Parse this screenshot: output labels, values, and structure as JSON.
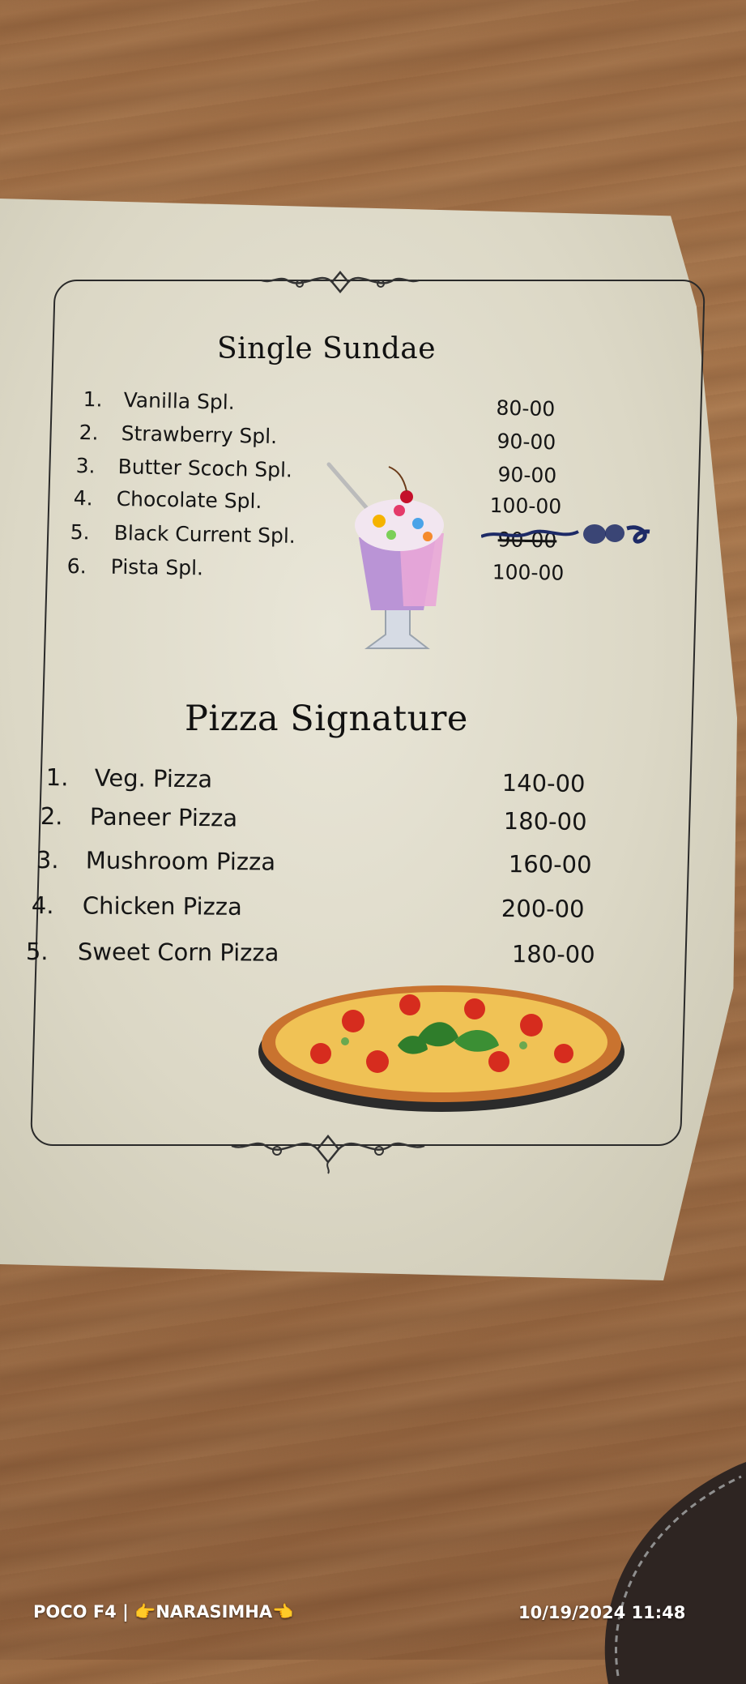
{
  "sections": {
    "sundae": {
      "title": "Single Sundae",
      "items": [
        {
          "num": "1.",
          "name": "Vanilla Spl.",
          "price": "80-00"
        },
        {
          "num": "2.",
          "name": "Strawberry Spl.",
          "price": "90-00"
        },
        {
          "num": "3.",
          "name": "Butter Scoch Spl.",
          "price": "90-00"
        },
        {
          "num": "4.",
          "name": "Chocolate Spl.",
          "price": "100-00"
        },
        {
          "num": "5.",
          "name": "Black Current Spl.",
          "price": "90-00"
        },
        {
          "num": "6.",
          "name": "Pista Spl.",
          "price": "100-00"
        }
      ]
    },
    "pizza": {
      "title": "Pizza Signature",
      "items": [
        {
          "num": "1.",
          "name": "Veg. Pizza",
          "price": "140-00"
        },
        {
          "num": "2.",
          "name": "Paneer Pizza",
          "price": "180-00"
        },
        {
          "num": "3.",
          "name": "Mushroom  Pizza",
          "price": "160-00"
        },
        {
          "num": "4.",
          "name": "Chicken Pizza",
          "price": "200-00"
        },
        {
          "num": "5.",
          "name": "Sweet Corn Pizza",
          "price": "180-00"
        }
      ]
    }
  },
  "watermark": {
    "device": "POCO F4 | 👉NARASIMHA👈",
    "datetime": "10/19/2024  11:48"
  },
  "colors": {
    "table_wood": "#9a6a43",
    "paper": "#e3e0d0",
    "ink": "#151515"
  }
}
